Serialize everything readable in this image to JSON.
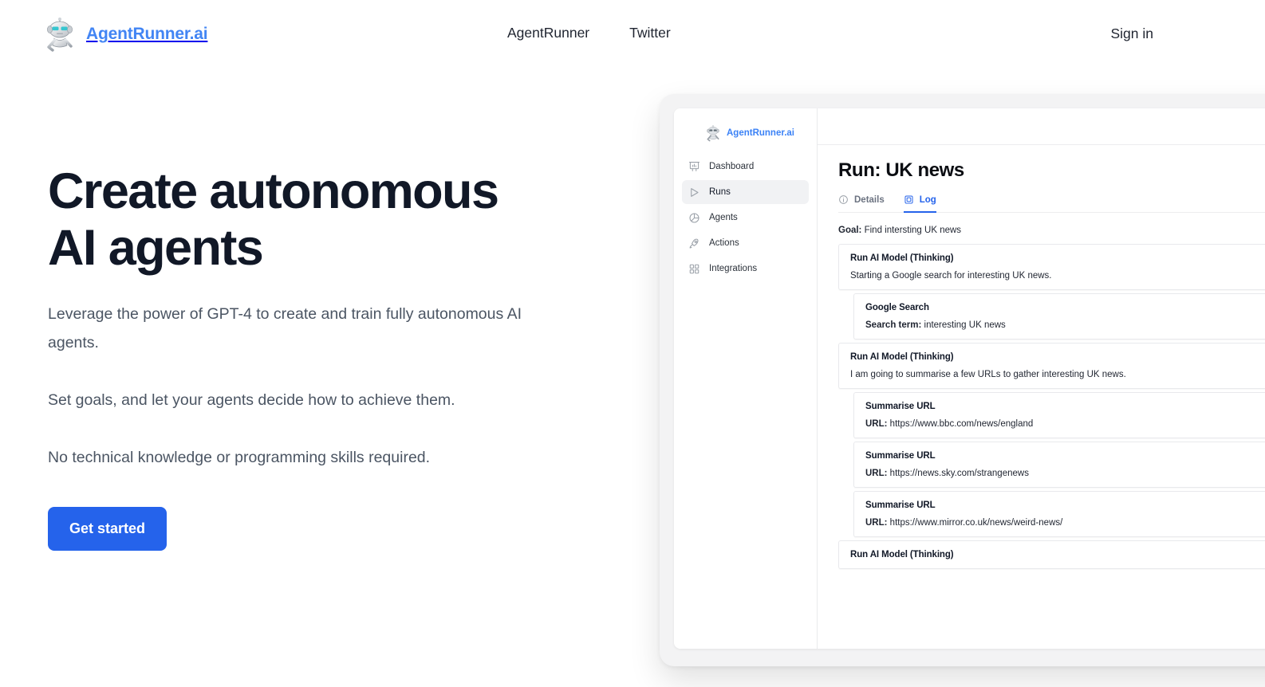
{
  "colors": {
    "brand_blue": "#4285f4",
    "cta_blue": "#2563eb",
    "heading": "#111827",
    "body_text": "#4b5563",
    "sidebar_active_bg": "#f1f2f4"
  },
  "topnav": {
    "brand_name": "AgentRunner.ai",
    "logo_icon": "robot-icon",
    "links": [
      {
        "label": "AgentRunner"
      },
      {
        "label": "Twitter"
      }
    ],
    "signin_label": "Sign in"
  },
  "hero": {
    "heading_line1": "Create autonomous",
    "heading_line2": "AI agents",
    "paragraphs": [
      "Leverage the power of GPT-4 to create and train fully autonomous AI agents.",
      "Set goals, and let your agents decide how to achieve them.",
      "No technical knowledge or programming skills required."
    ],
    "cta_label": "Get started"
  },
  "app": {
    "sidebar": {
      "brand_name": "AgentRunner.ai",
      "logo_icon": "robot-icon",
      "items": [
        {
          "label": "Dashboard",
          "icon": "presentation-chart-icon",
          "active": false
        },
        {
          "label": "Runs",
          "icon": "play-triangle-icon",
          "active": true
        },
        {
          "label": "Agents",
          "icon": "pie-circle-icon",
          "active": false
        },
        {
          "label": "Actions",
          "icon": "rocket-icon",
          "active": false
        },
        {
          "label": "Integrations",
          "icon": "grid-squares-icon",
          "active": false
        }
      ]
    },
    "run": {
      "title": "Run: UK news",
      "tabs": [
        {
          "label": "Details",
          "icon": "info-circle-icon",
          "active": false
        },
        {
          "label": "Log",
          "icon": "chip-square-icon",
          "active": true
        }
      ],
      "goal_label": "Goal:",
      "goal_value": "Find intersting UK news",
      "log_entries": [
        {
          "title": "Run AI Model (Thinking)",
          "text": "Starting a Google search for interesting UK news.",
          "indent": false
        },
        {
          "title": "Google Search",
          "field_label": "Search term:",
          "field_value": "interesting UK news",
          "indent": true
        },
        {
          "title": "Run AI Model (Thinking)",
          "text": "I am going to summarise a few URLs to gather interesting UK news.",
          "indent": false
        },
        {
          "title": "Summarise URL",
          "field_label": "URL:",
          "field_value": "https://www.bbc.com/news/england",
          "indent": true
        },
        {
          "title": "Summarise URL",
          "field_label": "URL:",
          "field_value": "https://news.sky.com/strangenews",
          "indent": true
        },
        {
          "title": "Summarise URL",
          "field_label": "URL:",
          "field_value": "https://www.mirror.co.uk/news/weird-news/",
          "indent": true
        },
        {
          "title": "Run AI Model (Thinking)",
          "text": "",
          "indent": false
        }
      ]
    }
  }
}
